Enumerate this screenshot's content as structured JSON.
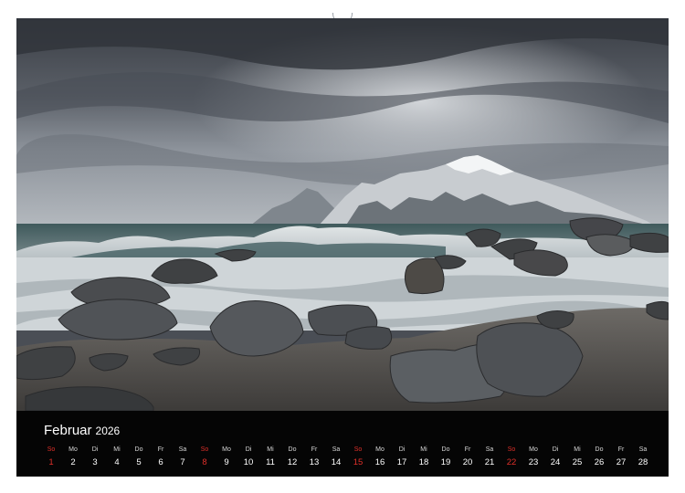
{
  "calendar": {
    "month": "Februar",
    "year": "2026",
    "days": [
      {
        "weekday": "So",
        "day": "1",
        "sunday": true
      },
      {
        "weekday": "Mo",
        "day": "2"
      },
      {
        "weekday": "Di",
        "day": "3"
      },
      {
        "weekday": "Mi",
        "day": "4"
      },
      {
        "weekday": "Do",
        "day": "5"
      },
      {
        "weekday": "Fr",
        "day": "6"
      },
      {
        "weekday": "Sa",
        "day": "7"
      },
      {
        "weekday": "So",
        "day": "8",
        "sunday": true
      },
      {
        "weekday": "Mo",
        "day": "9"
      },
      {
        "weekday": "Di",
        "day": "10"
      },
      {
        "weekday": "Mi",
        "day": "11"
      },
      {
        "weekday": "Do",
        "day": "12"
      },
      {
        "weekday": "Fr",
        "day": "13"
      },
      {
        "weekday": "Sa",
        "day": "14"
      },
      {
        "weekday": "So",
        "day": "15",
        "sunday": true
      },
      {
        "weekday": "Mo",
        "day": "16"
      },
      {
        "weekday": "Di",
        "day": "17"
      },
      {
        "weekday": "Mi",
        "day": "18"
      },
      {
        "weekday": "Do",
        "day": "19"
      },
      {
        "weekday": "Fr",
        "day": "20"
      },
      {
        "weekday": "Sa",
        "day": "21"
      },
      {
        "weekday": "So",
        "day": "22",
        "sunday": true
      },
      {
        "weekday": "Mo",
        "day": "23"
      },
      {
        "weekday": "Di",
        "day": "24"
      },
      {
        "weekday": "Mi",
        "day": "25"
      },
      {
        "weekday": "Do",
        "day": "26"
      },
      {
        "weekday": "Fr",
        "day": "27"
      },
      {
        "weekday": "Sa",
        "day": "28"
      }
    ]
  },
  "colors": {
    "sunday": "#e0302a",
    "strip": "#050505",
    "text": "#ffffff"
  }
}
